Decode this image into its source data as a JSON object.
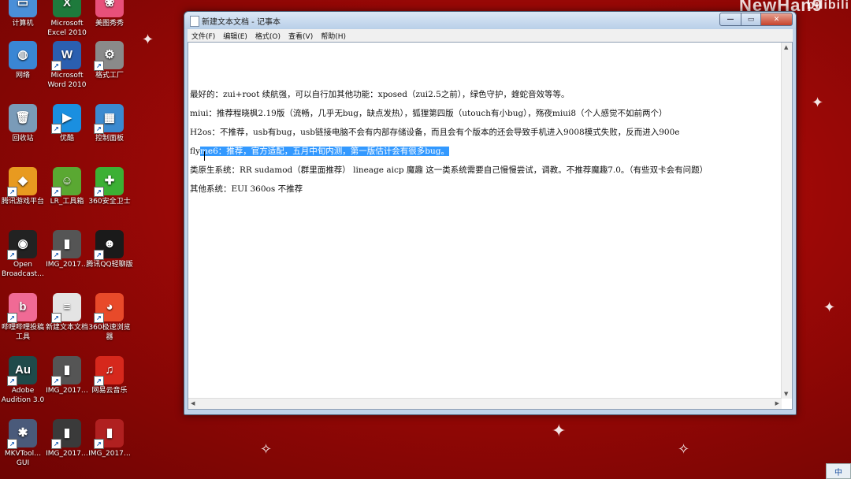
{
  "desktop": {
    "watermark": "NewHan9",
    "icons": [
      {
        "label": "计算机",
        "glyph": "▭",
        "color": "#4a8fd8"
      },
      {
        "label": "Microsoft Excel 2010",
        "glyph": "X",
        "color": "#1e7a3c"
      },
      {
        "label": "美图秀秀",
        "glyph": "❀",
        "color": "#e8507a"
      },
      {
        "label": "网络",
        "glyph": "◍",
        "color": "#3a86d4"
      },
      {
        "label": "Microsoft Word 2010",
        "glyph": "W",
        "color": "#2b5fb0"
      },
      {
        "label": "格式工厂",
        "glyph": "⚙",
        "color": "#8a8a8a"
      },
      {
        "label": "回收站",
        "glyph": "🗑",
        "color": "#7a9bb8"
      },
      {
        "label": "优酷",
        "glyph": "▶",
        "color": "#1a8fe0"
      },
      {
        "label": "控制面板",
        "glyph": "▦",
        "color": "#3b8ad0"
      },
      {
        "label": "腾讯游戏平台",
        "glyph": "◆",
        "color": "#e89a20"
      },
      {
        "label": "LR_工具箱",
        "glyph": "☺",
        "color": "#5aa832"
      },
      {
        "label": "360安全卫士",
        "glyph": "✚",
        "color": "#3cb034"
      },
      {
        "label": "Open Broadcast…",
        "glyph": "◉",
        "color": "#222222"
      },
      {
        "label": "IMG_2017…",
        "glyph": "▮",
        "color": "#555555"
      },
      {
        "label": "腾讯QQ轻聊版",
        "glyph": "☻",
        "color": "#1a1a1a"
      },
      {
        "label": "哔哩哔哩投稿工具",
        "glyph": "b",
        "color": "#f06a95"
      },
      {
        "label": "新建文本文档",
        "glyph": "≡",
        "color": "#e4e4e4"
      },
      {
        "label": "360极速浏览器",
        "glyph": "◕",
        "color": "#e84a2a"
      },
      {
        "label": "Adobe Audition 3.0",
        "glyph": "Au",
        "color": "#1f4a4a"
      },
      {
        "label": "IMG_2017…",
        "glyph": "▮",
        "color": "#555555"
      },
      {
        "label": "网易云音乐",
        "glyph": "♫",
        "color": "#d6281c"
      },
      {
        "label": "MKVTool… GUI",
        "glyph": "✱",
        "color": "#4a5a7a"
      },
      {
        "label": "IMG_2017…",
        "glyph": "▮",
        "color": "#3a3a3a"
      },
      {
        "label": "IMG_2017…",
        "glyph": "▮",
        "color": "#b02020"
      }
    ],
    "tray_lang": "中"
  },
  "notepad": {
    "title": "新建文本文档 - 记事本",
    "menu": [
      "文件(F)",
      "编辑(E)",
      "格式(O)",
      "查看(V)",
      "帮助(H)"
    ],
    "lines": [
      "最好的：zui+root    续航强，可以自行加其他功能：xposed（zui2.5之前），绿色守护，蝰蛇音效等等。",
      "miui：推荐程晓枫2.19版（流畅，几乎无bug，缺点发热），狐狸第四版（utouch有小bug），殇夜miui8（个人感觉不如前两个）",
      "H2os：不推荐，usb有bug，usb链接电脑不会有内部存储设备，而且会有个版本的还会导致手机进入9008模式失败，反而进入900e",
      "",
      "类原生系统：RR sudamod（群里面推荐） lineage aicp 魔趣 这一类系统需要自己慢慢尝试，调教。不推荐魔趣7.0。（有些双卡会有问题）",
      "其他系统：EUI 360os 不推荐"
    ],
    "line4_prefix": "fly",
    "line4_selected": "me6：推荐，官方适配，五月中旬内测，第一版估计会有很多bug。"
  }
}
